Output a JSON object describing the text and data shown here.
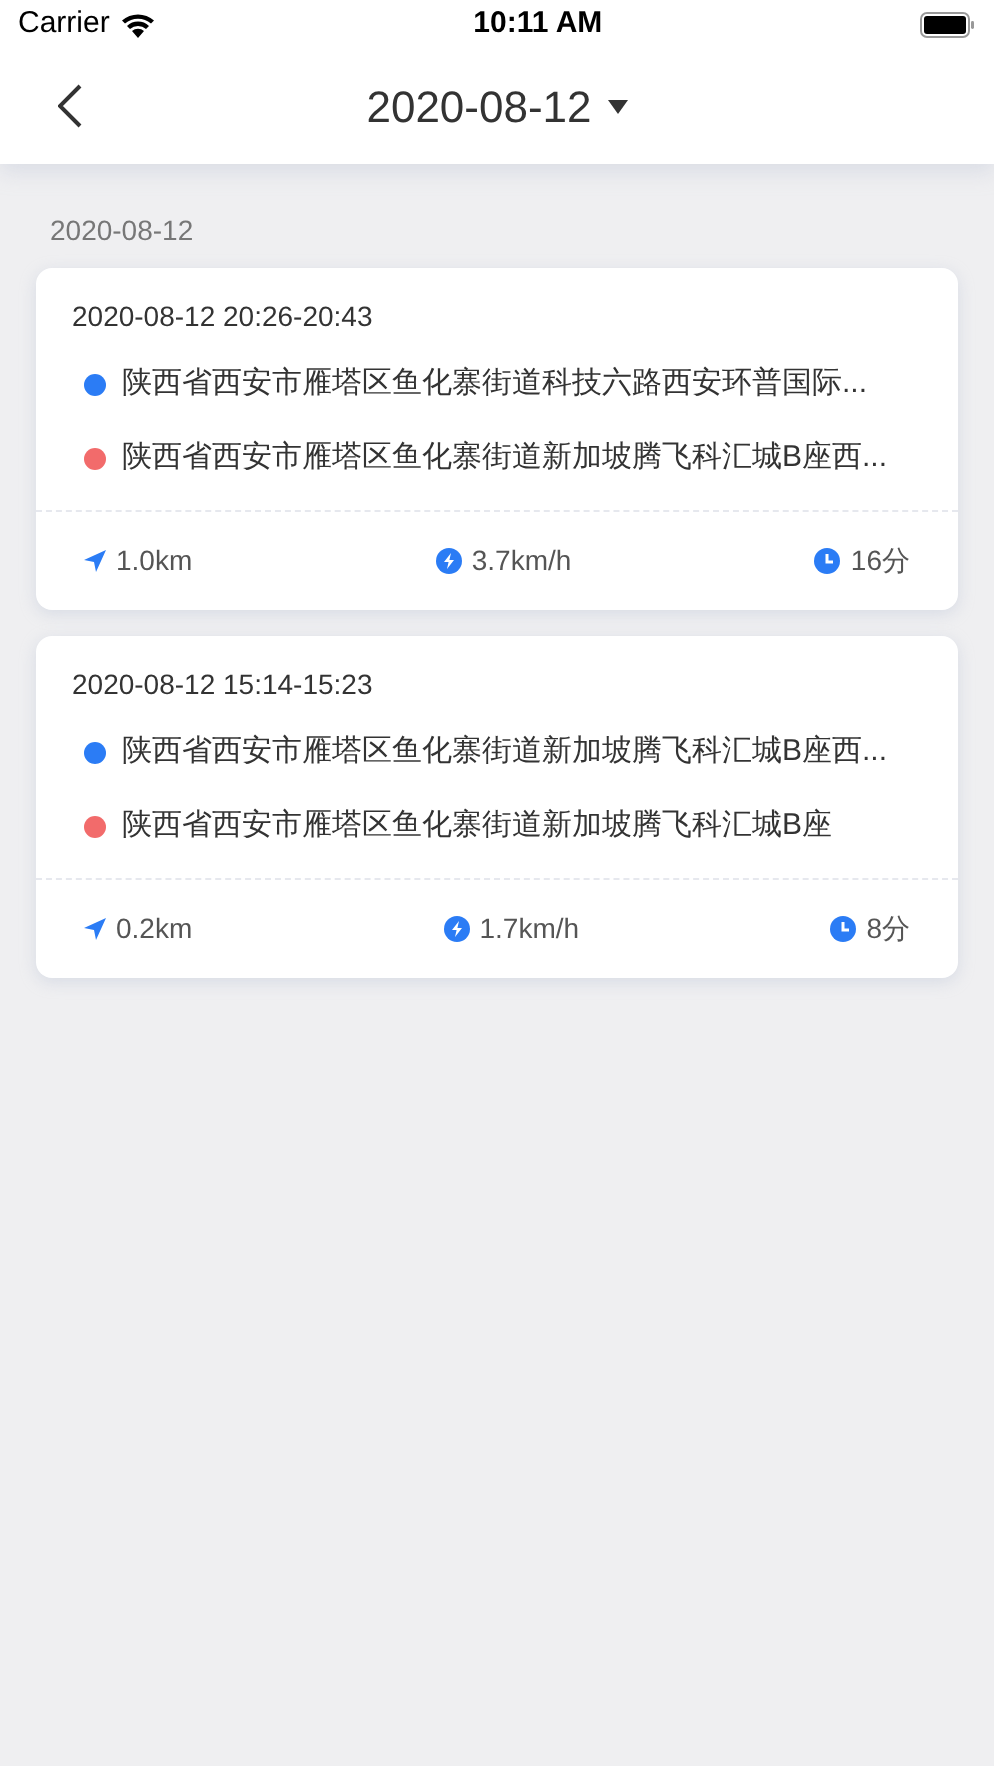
{
  "status_bar": {
    "carrier": "Carrier",
    "time": "10:11 AM"
  },
  "nav": {
    "title": "2020-08-12"
  },
  "section": {
    "date": "2020-08-12"
  },
  "trips": [
    {
      "time": "2020-08-12 20:26-20:43",
      "points": [
        {
          "address": "陕西省西安市雁塔区鱼化寨街道科技六路西安环普国际...",
          "color": "#2b7cf5"
        },
        {
          "address": "陕西省西安市雁塔区鱼化寨街道新加坡腾飞科汇城B座西...",
          "color": "#f26b6b"
        }
      ],
      "distance": "1.0km",
      "speed": "3.7km/h",
      "duration": "16分"
    },
    {
      "time": "2020-08-12 15:14-15:23",
      "points": [
        {
          "address": "陕西省西安市雁塔区鱼化寨街道新加坡腾飞科汇城B座西...",
          "color": "#2b7cf5"
        },
        {
          "address": "陕西省西安市雁塔区鱼化寨街道新加坡腾飞科汇城B座",
          "color": "#f26b6b"
        }
      ],
      "distance": "0.2km",
      "speed": "1.7km/h",
      "duration": "8分"
    }
  ]
}
